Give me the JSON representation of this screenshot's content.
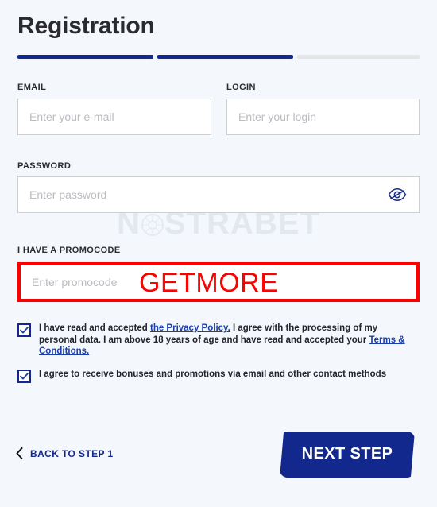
{
  "page": {
    "title": "Registration",
    "background_color": "#f4f8fc",
    "brand_color": "#12288c",
    "annotation_color": "#ff0000"
  },
  "progress": {
    "segments": [
      {
        "state": "active"
      },
      {
        "state": "active"
      },
      {
        "state": "inactive"
      }
    ]
  },
  "watermark": {
    "text_before": "N",
    "text_after": "STRABET"
  },
  "fields": {
    "email": {
      "label": "EMAIL",
      "placeholder": "Enter your e-mail",
      "value": ""
    },
    "login": {
      "label": "LOGIN",
      "placeholder": "Enter your login",
      "value": ""
    },
    "password": {
      "label": "PASSWORD",
      "placeholder": "Enter password",
      "value": "",
      "toggle_icon": "eye-off-icon"
    },
    "promocode": {
      "label": "I HAVE A PROMOCODE",
      "placeholder": "Enter promocode",
      "value": "",
      "highlight_color": "#ff0000",
      "annotation": "GETMORE"
    }
  },
  "consents": [
    {
      "checked": true,
      "text_part_1": "I have read and accepted ",
      "link_1": "the Privacy Policy.",
      "text_part_2": " I agree with the processing of my personal data. I am above 18 years of age and have read and accepted your ",
      "link_2": "Terms & Conditions."
    },
    {
      "checked": true,
      "text_part_1": "I agree to receive bonuses and promotions via email and other contact methods"
    }
  ],
  "footer": {
    "back_label": "BACK TO STEP 1",
    "back_icon": "chevron-left-icon",
    "next_label": "NEXT STEP"
  }
}
